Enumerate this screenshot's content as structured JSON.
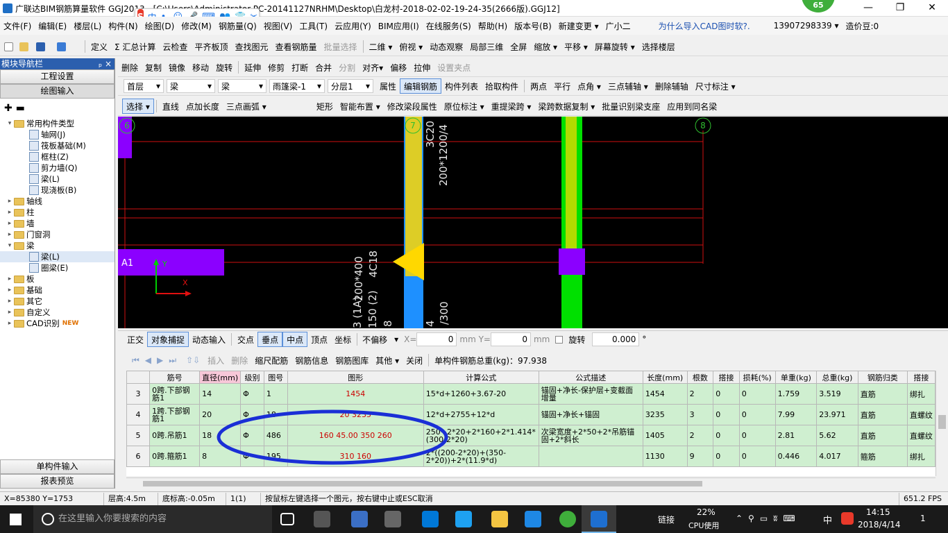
{
  "title": "广联达BIM钢筋算量软件 GGJ2013 - [C:\\Users\\Administrator-PC-20141127NRHM\\Desktop\\白龙村-2018-02-02-19-24-35(2666版).GGJ12]",
  "ime": {
    "logo": "S",
    "items": [
      "中",
      "•,",
      "☺",
      "🎤",
      "⌨",
      "👥",
      "👕",
      "✂"
    ]
  },
  "badge": "65",
  "window_controls": {
    "min": "—",
    "max": "❐",
    "close": "✕"
  },
  "menu": [
    "文件(F)",
    "编辑(E)",
    "楼层(L)",
    "构件(N)",
    "绘图(D)",
    "修改(M)",
    "钢筋量(Q)",
    "视图(V)",
    "工具(T)",
    "云应用(Y)",
    "BIM应用(I)",
    "在线服务(S)",
    "帮助(H)",
    "版本号(B)",
    "新建变更 ▾",
    "广小二",
    "为什么导入CAD图时软?.",
    "13907298339 ▾",
    "造价豆:0"
  ],
  "toolbar1": [
    "定义",
    "Σ 汇总计算",
    "云检查",
    "平齐板顶",
    "查找图元",
    "查看钢筋量",
    "批量选择",
    "二维 ▾",
    "俯视 ▾",
    "动态观察",
    "局部三维",
    "全屏",
    "缩放 ▾",
    "平移 ▾",
    "屏幕旋转 ▾",
    "选择楼层"
  ],
  "toolbar2": [
    "删除",
    "复制",
    "镜像",
    "移动",
    "旋转",
    "延伸",
    "修剪",
    "打断",
    "合并",
    "分割",
    "对齐▾",
    "偏移",
    "拉伸",
    "设置夹点"
  ],
  "toolbar3": {
    "floor": "首层",
    "type1": "梁",
    "type2": "梁",
    "name": "雨篷梁-1",
    "layer": "分层1",
    "buttons": [
      "属性",
      "编辑钢筋",
      "构件列表",
      "拾取构件",
      "两点",
      "平行",
      "点角 ▾",
      "三点辅轴 ▾",
      "删除辅轴",
      "尺寸标注 ▾"
    ]
  },
  "toolbar4": [
    "选择 ▾",
    "直线",
    "点加长度",
    "三点画弧 ▾",
    "矩形",
    "智能布置 ▾",
    "修改梁段属性",
    "原位标注 ▾",
    "重提梁跨 ▾",
    "梁跨数据复制 ▾",
    "批量识别梁支座",
    "应用到同名梁"
  ],
  "nav": {
    "header": "模块导航栏",
    "pin": "ₚ ×",
    "btn1": "工程设置",
    "btn2": "绘图输入",
    "bottom1": "单构件输入",
    "bottom2": "报表预览",
    "tree": [
      {
        "t": "常用构件类型",
        "lv": 0,
        "tg": "▾",
        "f": 1
      },
      {
        "t": "轴网(J)",
        "lv": 1
      },
      {
        "t": "筏板基础(M)",
        "lv": 1
      },
      {
        "t": "框柱(Z)",
        "lv": 1
      },
      {
        "t": "剪力墙(Q)",
        "lv": 1
      },
      {
        "t": "梁(L)",
        "lv": 1
      },
      {
        "t": "现浇板(B)",
        "lv": 1
      },
      {
        "t": "轴线",
        "lv": 0,
        "tg": "▸",
        "f": 1
      },
      {
        "t": "柱",
        "lv": 0,
        "tg": "▸",
        "f": 1
      },
      {
        "t": "墙",
        "lv": 0,
        "tg": "▸",
        "f": 1
      },
      {
        "t": "门窗洞",
        "lv": 0,
        "tg": "▸",
        "f": 1
      },
      {
        "t": "梁",
        "lv": 0,
        "tg": "▾",
        "f": 1
      },
      {
        "t": "梁(L)",
        "lv": 1,
        "sel": 1
      },
      {
        "t": "圈梁(E)",
        "lv": 1
      },
      {
        "t": "板",
        "lv": 0,
        "tg": "▸",
        "f": 1
      },
      {
        "t": "基础",
        "lv": 0,
        "tg": "▸",
        "f": 1
      },
      {
        "t": "其它",
        "lv": 0,
        "tg": "▸",
        "f": 1
      },
      {
        "t": "自定义",
        "lv": 0,
        "tg": "▸",
        "f": 1
      },
      {
        "t": "CAD识别",
        "lv": 0,
        "tg": "▸",
        "f": 1,
        "new": "NEW"
      }
    ]
  },
  "canvas": {
    "axis_left": "6",
    "axis_mid": "7",
    "axis_right": "8",
    "axis_a": "A1",
    "y_label": "Y",
    "x_label": "X",
    "t1": "3C20",
    "t2": "200*1200/4",
    "t3": "200*400",
    "t4": "4C18",
    "t5": "3 (1A)",
    "t6": "150 (2)",
    "t7": "8",
    "t8": "4",
    "t9": "/300"
  },
  "snapbar": {
    "items": [
      "正交",
      "对象捕捉",
      "动态输入",
      "交点",
      "垂点",
      "中点",
      "顶点",
      "坐标"
    ],
    "offset": "不偏移",
    "x_label": "X=",
    "x_val": "0",
    "y_label": "mm Y=",
    "y_val": "0",
    "mm": "mm",
    "rotate": "旋转",
    "rot_val": "0.000",
    "deg": "°"
  },
  "rebarbar": {
    "items": [
      "插入",
      "删除",
      "缩尺配筋",
      "钢筋信息",
      "钢筋图库",
      "其他 ▾",
      "关闭"
    ],
    "total": "单构件钢筋总重(kg)：97.938"
  },
  "grid": {
    "headers": [
      "",
      "筋号",
      "直径(mm)",
      "级别",
      "图号",
      "图形",
      "计算公式",
      "公式描述",
      "长度(mm)",
      "根数",
      "搭接",
      "损耗(%)",
      "单重(kg)",
      "总重(kg)",
      "钢筋归类",
      "搭接"
    ],
    "rows": [
      [
        "3",
        "0跨.下部钢筋1",
        "14",
        "Φ",
        "1",
        "1454",
        "15*d+1260+3.67-20",
        "锚固+净长-保护层+变截面增量",
        "1454",
        "2",
        "0",
        "0",
        "1.759",
        "3.519",
        "直筋",
        "绑扎"
      ],
      [
        "4",
        "1跨.下部钢筋1",
        "20",
        "Φ",
        "18",
        "20  3235",
        "12*d+2755+12*d",
        "锚固+净长+锚固",
        "3235",
        "3",
        "0",
        "0",
        "7.99",
        "23.971",
        "直筋",
        "直螺纹"
      ],
      [
        "5",
        "0跨.吊筋1",
        "18",
        "Φ",
        "486",
        "160 45.00 350 260",
        "250+2*20+2*160+2*1.414*(300-2*20)",
        "次梁宽度+2*50+2*吊筋锚固+2*斜长",
        "1405",
        "2",
        "0",
        "0",
        "2.81",
        "5.62",
        "直筋",
        "直螺纹"
      ],
      [
        "6",
        "0跨.箍筋1",
        "8",
        "Φ",
        "195",
        "310 160",
        "2*((200-2*20)+(350-2*20))+2*(11.9*d)",
        "",
        "1130",
        "9",
        "0",
        "0",
        "0.446",
        "4.017",
        "箍筋",
        "绑扎"
      ]
    ]
  },
  "status": [
    "X=85380 Y=1753",
    "层高:4.5m",
    "底标高:-0.05m",
    "1(1)",
    "按鼠标左键选择一个图元，按右键中止或ESC取消",
    "651.2 FPS"
  ],
  "taskbar": {
    "search": "在这里输入你要搜索的内容",
    "link": "链接",
    "cpu": "22%",
    "cpu_label": "CPU使用",
    "lang": "中",
    "time": "14:15",
    "date": "2018/4/14",
    "notif": "1"
  },
  "colors": {
    "canvas_bg": "#000000",
    "beam_purple": "#8b00ff",
    "column_blue": "#1e90ff",
    "column_green": "#00e000",
    "axis_red": "#d01010",
    "annot_blue": "#1a2fd6"
  }
}
